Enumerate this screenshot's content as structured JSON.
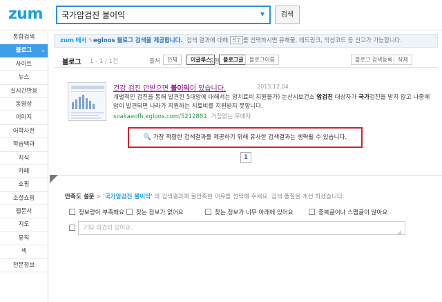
{
  "header": {
    "logo": "zum",
    "search_value": "국가암검진 불이익",
    "search_dropdown": "▼",
    "search_button": "검색"
  },
  "sidebar": {
    "items": [
      {
        "label": "통합검색"
      },
      {
        "label": "블로그",
        "active": true
      },
      {
        "label": "사이트"
      },
      {
        "label": "뉴스"
      },
      {
        "label": "실시간반응"
      },
      {
        "label": "동영상"
      },
      {
        "label": "이미지"
      },
      {
        "label": "어학사전"
      },
      {
        "label": "학습백과"
      },
      {
        "label": "지식"
      },
      {
        "label": "카페"
      },
      {
        "label": "쇼핑"
      },
      {
        "label": "소셜쇼핑"
      },
      {
        "label": "웹문서"
      },
      {
        "label": "지도"
      },
      {
        "label": "뮤직"
      },
      {
        "label": "책"
      },
      {
        "label": "전문정보"
      }
    ]
  },
  "notice": {
    "zum": "zum",
    "in": "에서",
    "egloos": "egloos 블로그 검색을 제공합니다.",
    "text_a": "검색 결과에 대해",
    "tag": "신고",
    "text_b": "를 선택하시면 유해물, 데드링크, 악성코드 등 신고가 가능합니다."
  },
  "results_header": {
    "title": "블로그",
    "count": "1 - 1 / 1건",
    "sort_label": "출처",
    "sort_all": "전체",
    "sort_egloos": "이글루스",
    "type_label": "유형",
    "type_blog": "블로그글",
    "type_name": "블로그이름",
    "register_button": "블로그 검색등록",
    "delete_button": "삭제"
  },
  "result": {
    "title_pre": "건강 검진 안받으면 ",
    "title_bold": "불이익",
    "title_post": "이 있습니다.",
    "date": "2013.12.04",
    "snippet_1": "개별적인 검진을 통해 발견된 5대암에 대해서는 암치료비 지원불가) 논산시보건소 ",
    "snippet_bold_1": "암검진",
    "snippet_2": " 대상자가 ",
    "snippet_bold_2": "국가",
    "snippet_3": "검진을 받지 않고 나중에 암이 발견되면 나라가 지원하는 치료비를 지원받지 못합니다.",
    "url": "soakaeofh.egloos.com/5212881",
    "author": "거침없는 무애자"
  },
  "omit_notice": "가장 적합한 검색결과를 제공하기 위해 유사한 검색결과는 생략될 수 있습니다.",
  "pagination": {
    "current": "1"
  },
  "survey": {
    "lead": "만족도 설문",
    "sep": " > ",
    "query": "'국가암검진 불이익'",
    "text": " 의 검색결과에 불만족한 이유를 선택해 주세요. 검색 품질을 개선 하겠습니다.",
    "options": [
      "정보량이 부족해요",
      "찾는 정보가 없어요",
      "찾는 정보가 너무 아래에 있어요",
      "중복글이나 스팸글이 많아요"
    ],
    "input_placeholder": "기타 의견이 있어요."
  },
  "colors": {
    "brand": "#1a9ee6",
    "active_tab": "#3e9ee8",
    "highlight_border": "#d0202a",
    "url_green": "#2b9a4a"
  }
}
